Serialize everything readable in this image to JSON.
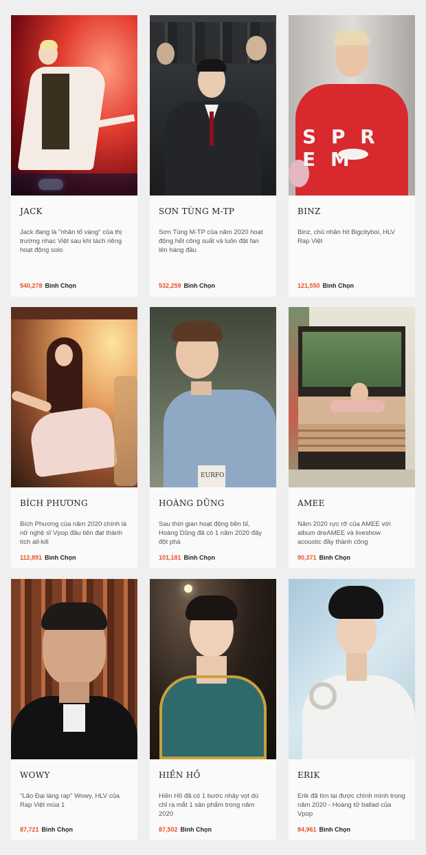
{
  "votes_label": "Bình Chọn",
  "colors": {
    "accent": "#e8512b",
    "card": "#fafafa",
    "page": "#efefef"
  },
  "artists": [
    {
      "name": "JACK",
      "description": "Jack đang là \"nhân tố vàng\" của thị trường nhạc Việt sau khi tách riêng hoạt động solo",
      "votes": "540,278",
      "photo": "jack-photo"
    },
    {
      "name": "SƠN TÙNG M-TP",
      "description": "Sơn Tùng M-TP của năm 2020 hoạt động hết công suất và luôn đặt fan lên hàng đầu",
      "votes": "532,259",
      "photo": "son-tung-photo"
    },
    {
      "name": "BINZ",
      "description": "Binz, chủ nhân hit Bigcityboi, HLV Rap Việt",
      "votes": "121,550",
      "photo": "binz-photo"
    },
    {
      "name": "BÍCH PHƯƠNG",
      "description": "Bích Phương của năm 2020 chính là nữ nghệ sĩ Vpop đầu tiên đạt thành tích all-kill",
      "votes": "112,891",
      "photo": "bich-phuong-photo"
    },
    {
      "name": "HOÀNG DŨNG",
      "description": "Sau thời gian hoạt động bền bỉ, Hoàng Dũng đã có 1 năm 2020 đầy đột phá",
      "votes": "101,181",
      "photo": "hoang-dung-photo"
    },
    {
      "name": "AMEE",
      "description": "Năm 2020 rực rỡ của AMEE với album dreAMEE và liveshow acoustic đầy thành công",
      "votes": "90,371",
      "photo": "amee-photo"
    },
    {
      "name": "WOWY",
      "description": "\"Lão Đại làng rap\" Wowy, HLV của Rap Việt mùa 1",
      "votes": "87,721",
      "photo": "wowy-photo"
    },
    {
      "name": "HIỀN HỒ",
      "description": "Hiền Hồ đã có 1 bước nhảy vọt dù chỉ ra mắt 1 sản phẩm trong năm 2020",
      "votes": "87,502",
      "photo": "hien-ho-photo"
    },
    {
      "name": "ERIK",
      "description": "Erik đã tìm lại được chính mình trong năm 2020 - Hoàng tử ballad của Vpop",
      "votes": "84,961",
      "photo": "erik-photo"
    }
  ]
}
